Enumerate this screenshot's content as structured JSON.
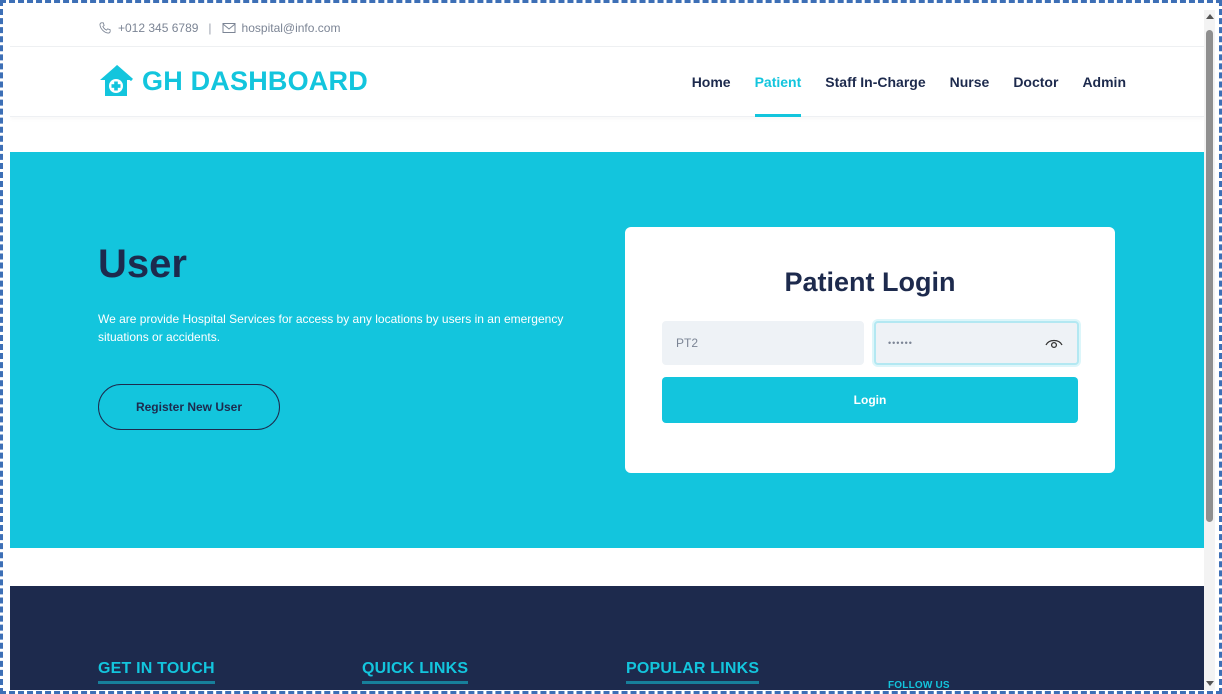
{
  "topbar": {
    "phone": "+012 345 6789",
    "separator": "|",
    "email": "hospital@info.com"
  },
  "brand": {
    "name": "GH DASHBOARD",
    "icon": "hospital-house-icon"
  },
  "nav": {
    "items": [
      {
        "label": "Home",
        "active": false
      },
      {
        "label": "Patient",
        "active": true
      },
      {
        "label": "Staff In-Charge",
        "active": false
      },
      {
        "label": "Nurse",
        "active": false
      },
      {
        "label": "Doctor",
        "active": false
      },
      {
        "label": "Admin",
        "active": false
      }
    ]
  },
  "hero": {
    "title": "User",
    "description": "We are provide Hospital Services for access by any locations by users in an emergency situations or accidents.",
    "register_label": "Register New User"
  },
  "login": {
    "title": "Patient Login",
    "username_value": "PT2",
    "password_value": "••••••",
    "button_label": "Login"
  },
  "footer": {
    "get_in_touch": "GET IN TOUCH",
    "quick_links": "QUICK LINKS",
    "popular_links": "POPULAR LINKS",
    "follow_us": "FOLLOW US"
  },
  "colors": {
    "primary": "#13c5dd",
    "dark": "#1d2a4d",
    "frame": "#3d6fb6"
  }
}
